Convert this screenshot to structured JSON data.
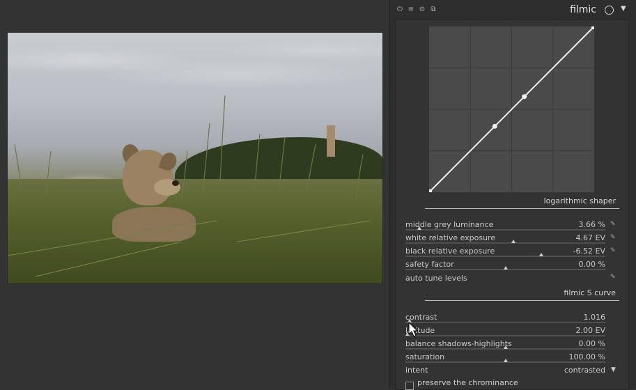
{
  "header": {
    "module_name": "filmic",
    "icons": [
      "power-icon",
      "presets-icon",
      "reset-icon",
      "duplicate-icon",
      "instance-circle-icon",
      "menu-arrow-icon"
    ]
  },
  "graph": {
    "curve": [
      [
        0,
        0
      ],
      [
        0.396,
        0.396
      ],
      [
        0.578,
        0.578
      ],
      [
        1,
        1
      ]
    ],
    "control_points": [
      [
        0.396,
        0.396
      ],
      [
        0.578,
        0.578
      ]
    ]
  },
  "sections": {
    "logarithmic_shaper": "logarithmic shaper",
    "filmic_s_curve": "filmic S curve"
  },
  "log_sliders": [
    {
      "label": "middle grey luminance",
      "value": "3.66 %",
      "level": 0.07,
      "picker": true
    },
    {
      "label": "white relative exposure",
      "value": "4.67 EV",
      "level": 0.54,
      "picker": true
    },
    {
      "label": "black relative exposure",
      "value": "-6.52 EV",
      "level": 0.68,
      "picker": true
    },
    {
      "label": "safety factor",
      "value": "0.00 %",
      "level": 0.5,
      "picker": false
    }
  ],
  "auto_tune": {
    "label": "auto tune levels"
  },
  "curve_sliders": [
    {
      "label": "contrast",
      "value": "1.016",
      "level": 0.02
    },
    {
      "label": "latitude",
      "value": "2.00 EV",
      "level": 0.01
    },
    {
      "label": "balance shadows-highlights",
      "value": "0.00 %",
      "level": 0.5
    },
    {
      "label": "saturation",
      "value": "100.00 %",
      "level": 0.5
    }
  ],
  "intent": {
    "label": "intent",
    "value": "contrasted"
  },
  "preserve_chrominance": {
    "label": "preserve the chrominance",
    "checked": false
  },
  "colors": {
    "accent": "#e0e0e0",
    "panel": "#2d2d2d",
    "graph": "#4a4a4a"
  }
}
